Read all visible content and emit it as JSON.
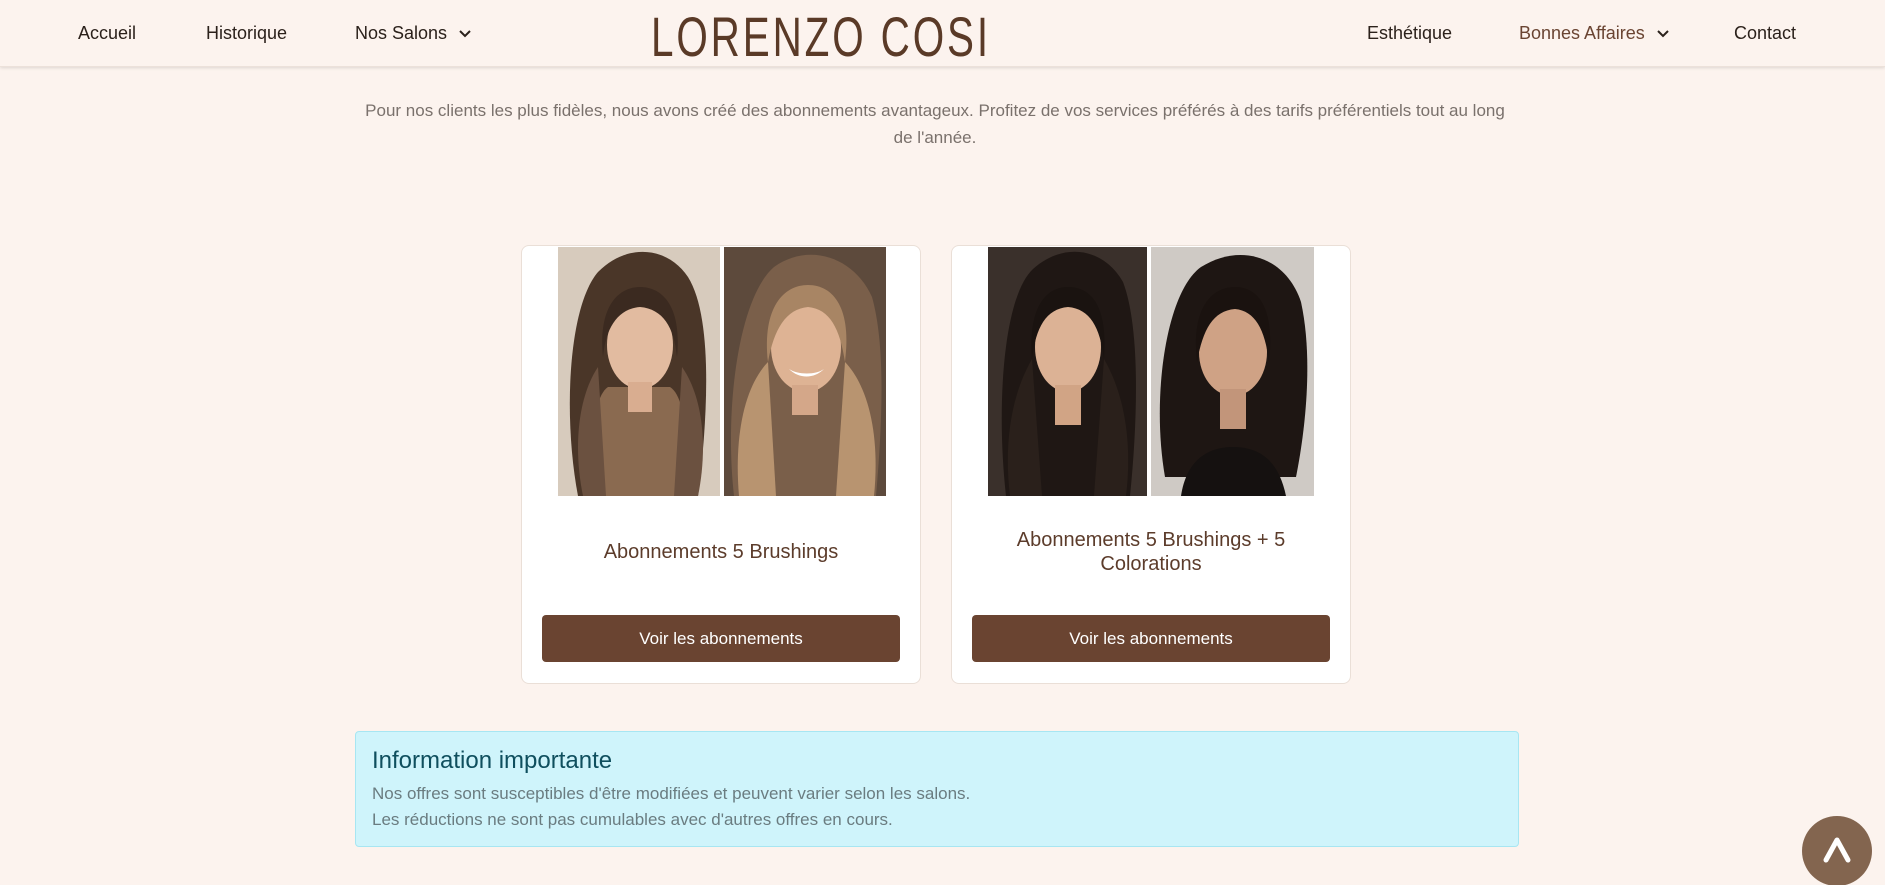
{
  "nav": {
    "left": [
      {
        "label": "Accueil"
      },
      {
        "label": "Historique"
      },
      {
        "label": "Nos Salons"
      }
    ],
    "right": [
      {
        "label": "Esthétique"
      },
      {
        "label": "Bonnes Affaires"
      },
      {
        "label": "Contact"
      }
    ],
    "logo_text": "LORENZO COSI"
  },
  "intro": {
    "text": "Pour nos clients les plus fidèles, nous avons créé des abonnements avantageux. Profitez de vos services préférés à des tarifs préférentiels tout au long de l'année."
  },
  "cards": [
    {
      "title": "Abonnements 5 Brushings",
      "button": "Voir les abonnements"
    },
    {
      "title": "Abonnements 5 Brushings + 5 Colorations",
      "button": "Voir les abonnements"
    }
  ],
  "info": {
    "title": "Information importante",
    "lines": [
      "Nos offres sont susceptibles d'être modifiées et peuvent varier selon les salons.",
      "Les réductions ne sont pas cumulables avec d'autres offres en cours."
    ]
  },
  "colors": {
    "background": "#fcf3ee",
    "brand_brown": "#6a4431",
    "info_bg": "#cff4fb"
  },
  "icons": {
    "scroll_top": "caret-up-icon",
    "dropdown": "chevron-down-icon"
  }
}
